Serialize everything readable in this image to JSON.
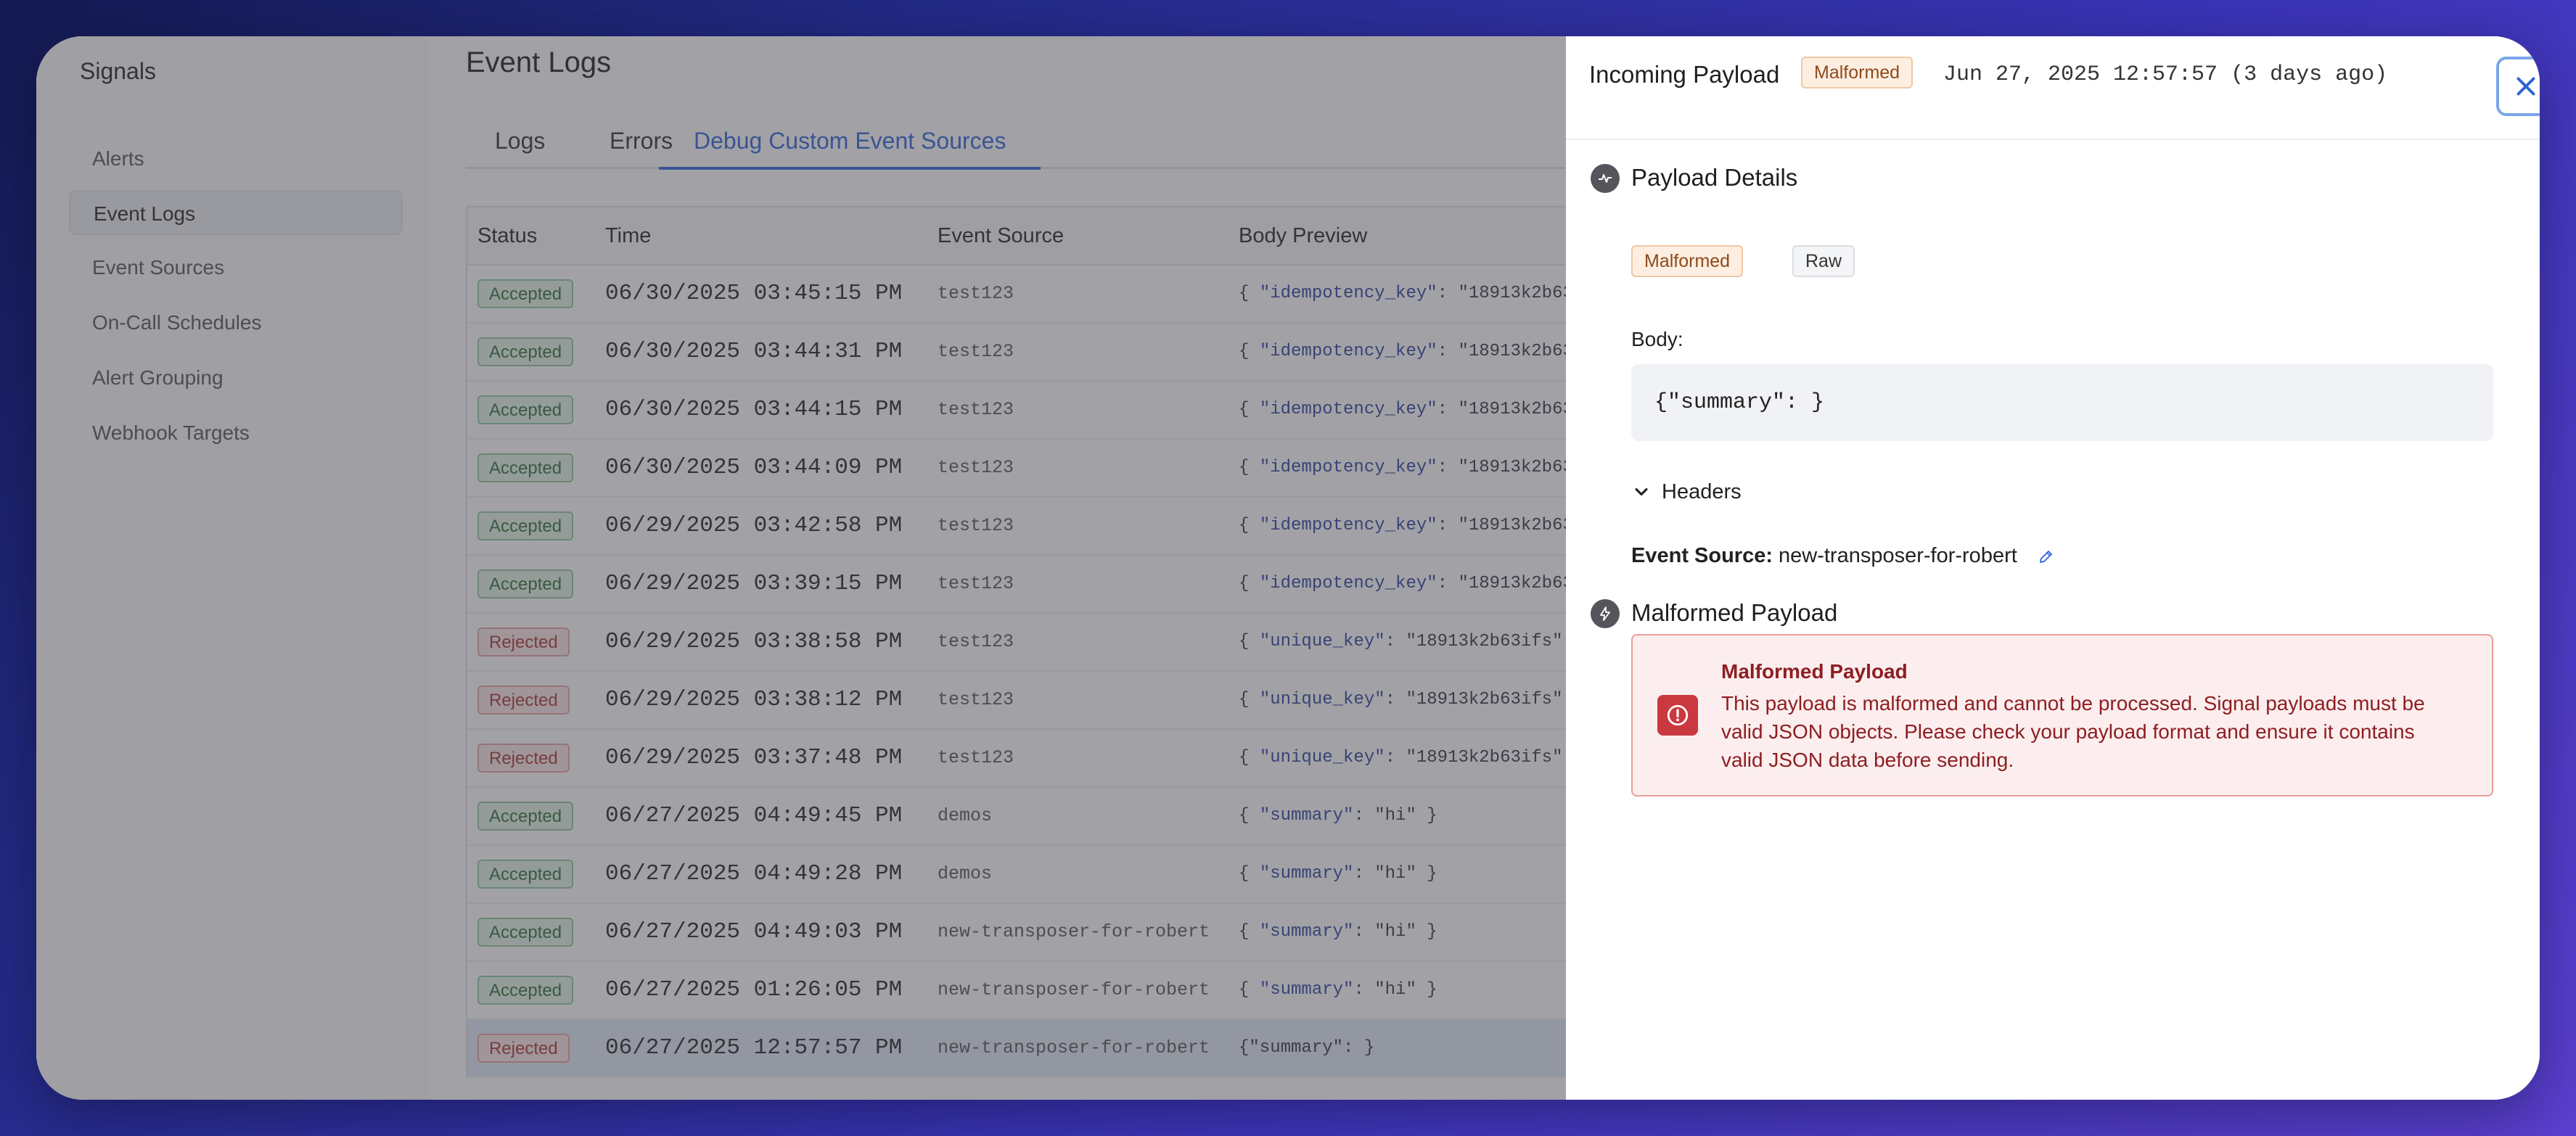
{
  "sidebar": {
    "title": "Signals",
    "items": [
      {
        "label": "Alerts",
        "active": false
      },
      {
        "label": "Event Logs",
        "active": true
      },
      {
        "label": "Event Sources",
        "active": false
      },
      {
        "label": "On-Call Schedules",
        "active": false
      },
      {
        "label": "Alert Grouping",
        "active": false
      },
      {
        "label": "Webhook Targets",
        "active": false
      }
    ]
  },
  "main": {
    "title": "Event Logs",
    "tabs": [
      {
        "label": "Logs",
        "active": false
      },
      {
        "label": "Errors",
        "active": false
      },
      {
        "label": "Debug Custom Event Sources",
        "active": true
      }
    ],
    "table": {
      "columns": [
        "Status",
        "Time",
        "Event Source",
        "Body Preview"
      ],
      "rows": [
        {
          "status": "Accepted",
          "time": "06/30/2025 03:45:15 PM",
          "source": "test123",
          "body_key": "\"idempotency_key\"",
          "body_rest": ": \"18913k2b63"
        },
        {
          "status": "Accepted",
          "time": "06/30/2025 03:44:31 PM",
          "source": "test123",
          "body_key": "\"idempotency_key\"",
          "body_rest": ": \"18913k2b63"
        },
        {
          "status": "Accepted",
          "time": "06/30/2025 03:44:15 PM",
          "source": "test123",
          "body_key": "\"idempotency_key\"",
          "body_rest": ": \"18913k2b63"
        },
        {
          "status": "Accepted",
          "time": "06/30/2025 03:44:09 PM",
          "source": "test123",
          "body_key": "\"idempotency_key\"",
          "body_rest": ": \"18913k2b63"
        },
        {
          "status": "Accepted",
          "time": "06/29/2025 03:42:58 PM",
          "source": "test123",
          "body_key": "\"idempotency_key\"",
          "body_rest": ": \"18913k2b63"
        },
        {
          "status": "Accepted",
          "time": "06/29/2025 03:39:15 PM",
          "source": "test123",
          "body_key": "\"idempotency_key\"",
          "body_rest": ": \"18913k2b63"
        },
        {
          "status": "Rejected",
          "time": "06/29/2025 03:38:58 PM",
          "source": "test123",
          "body_key": "\"unique_key\"",
          "body_rest": ": \"18913k2b63ifs\""
        },
        {
          "status": "Rejected",
          "time": "06/29/2025 03:38:12 PM",
          "source": "test123",
          "body_key": "\"unique_key\"",
          "body_rest": ": \"18913k2b63ifs\""
        },
        {
          "status": "Rejected",
          "time": "06/29/2025 03:37:48 PM",
          "source": "test123",
          "body_key": "\"unique_key\"",
          "body_rest": ": \"18913k2b63ifs\""
        },
        {
          "status": "Accepted",
          "time": "06/27/2025 04:49:45 PM",
          "source": "demos",
          "body_key": "\"summary\"",
          "body_rest": ": \"hi\" }"
        },
        {
          "status": "Accepted",
          "time": "06/27/2025 04:49:28 PM",
          "source": "demos",
          "body_key": "\"summary\"",
          "body_rest": ": \"hi\" }"
        },
        {
          "status": "Accepted",
          "time": "06/27/2025 04:49:03 PM",
          "source": "new-transposer-for-robert",
          "body_key": "\"summary\"",
          "body_rest": ": \"hi\" }"
        },
        {
          "status": "Accepted",
          "time": "06/27/2025 01:26:05 PM",
          "source": "new-transposer-for-robert",
          "body_key": "\"summary\"",
          "body_rest": ": \"hi\" }"
        },
        {
          "status": "Rejected",
          "time": "06/27/2025 12:57:57 PM",
          "source": "new-transposer-for-robert",
          "body_key": "",
          "body_rest": "{\"summary\": }",
          "selected": true
        }
      ]
    }
  },
  "drawer": {
    "title": "Incoming Payload",
    "status_tag": "Malformed",
    "timestamp": "Jun 27, 2025 12:57:57",
    "relative_time": "(3 days ago)",
    "payload_details": {
      "title": "Payload Details",
      "tag_malformed": "Malformed",
      "tag_raw": "Raw",
      "body_label": "Body:",
      "body_code": "{\"summary\": }",
      "headers_label": "Headers",
      "event_source_label": "Event Source:",
      "event_source_value": "new-transposer-for-robert"
    },
    "malformed": {
      "section_title": "Malformed Payload",
      "error_title": "Malformed Payload",
      "error_message": "This payload is malformed and cannot be processed. Signal payloads must be valid JSON objects. Please check your payload format and ensure it contains valid JSON data before sending."
    }
  },
  "colors": {
    "accent": "#2f63d8",
    "accepted": "#2c6e37",
    "rejected": "#a83232",
    "error": "#8e1e22"
  },
  "icons": [
    "close-icon",
    "activity-icon",
    "lightning-icon",
    "chevron-down-icon",
    "pencil-icon",
    "alert-circle-icon"
  ]
}
